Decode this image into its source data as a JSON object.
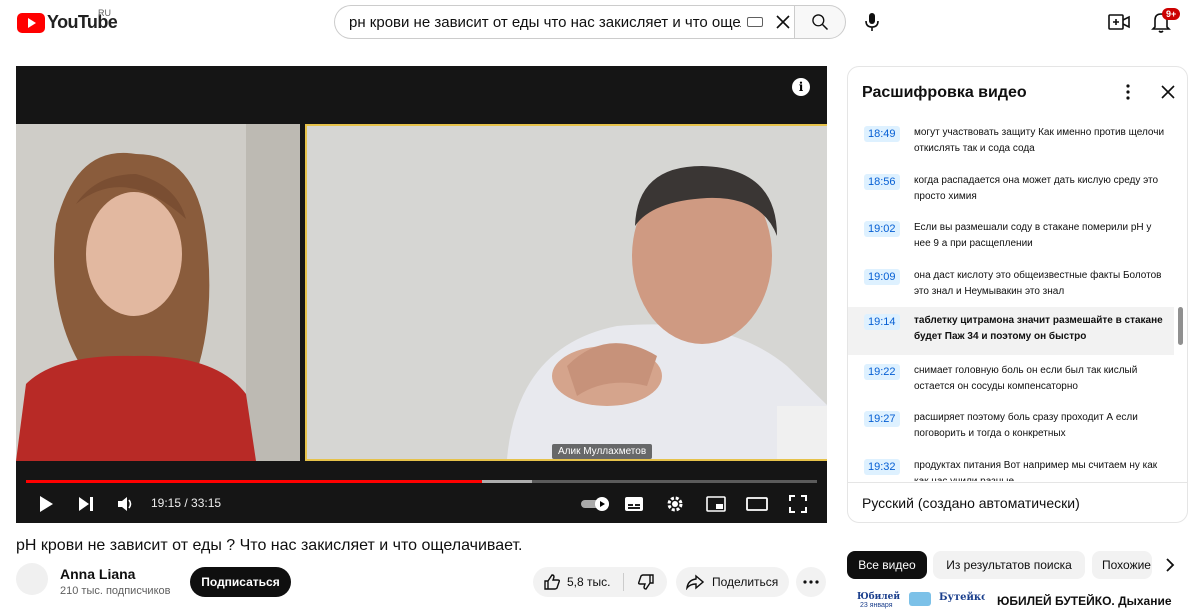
{
  "masthead": {
    "logo_text": "YouTube",
    "region": "RU",
    "search_query": "рн крови не зависит от еды что нас закисляет и что ощелачивает",
    "notifications": "9+"
  },
  "player": {
    "participant_name": "Алик Муллахметов",
    "time": "19:15 / 33:15",
    "progress": 0.5764,
    "buffered": 0.64
  },
  "video": {
    "title": "pH крови не зависит от еды ? Что нас закисляет и что ощелачивает.",
    "channel": "Anna Liana",
    "subscribers": "210 тыс. подписчиков",
    "subscribe_label": "Подписаться",
    "likes": "5,8 тыс.",
    "share_label": "Поделиться"
  },
  "transcript": {
    "title": "Расшифровка видео",
    "language": "Русский (создано автоматически)",
    "segments": [
      {
        "time": "18:49",
        "text": "могут участвовать защиту Как именно против щелочи откислять так и сода сода"
      },
      {
        "time": "18:56",
        "text": "когда распадается она может дать кислую среду это просто химия"
      },
      {
        "time": "19:02",
        "text": "Если вы размешали соду в стакане померили рН у нее 9 а при расщеплении"
      },
      {
        "time": "19:09",
        "text": "она даст кислоту это общеизвестные факты Болотов это знал и Неумывакин это знал"
      },
      {
        "time": "19:14",
        "text": "таблетку цитрамона значит размешайте в стакане будет Паж 34 и поэтому он быстро"
      },
      {
        "time": "19:22",
        "text": "снимает головную боль он если был так кислый остается он сосуды компенсаторно"
      },
      {
        "time": "19:27",
        "text": "расширяет поэтому боль сразу проходит А если поговорить и тогда о конкретных"
      },
      {
        "time": "19:32",
        "text": "продуктах питания Вот например мы считаем ну как как нас учили разные"
      }
    ]
  },
  "chips": [
    "Все видео",
    "Из результатов поиска",
    "Похожие"
  ],
  "recommendation": {
    "thumb_text_a": "Юбилей",
    "thumb_text_b": "Бутейко",
    "thumb_text_c": "23 января",
    "title": "ЮБИЛЕЙ БУТЕЙКО. Дыхание"
  }
}
